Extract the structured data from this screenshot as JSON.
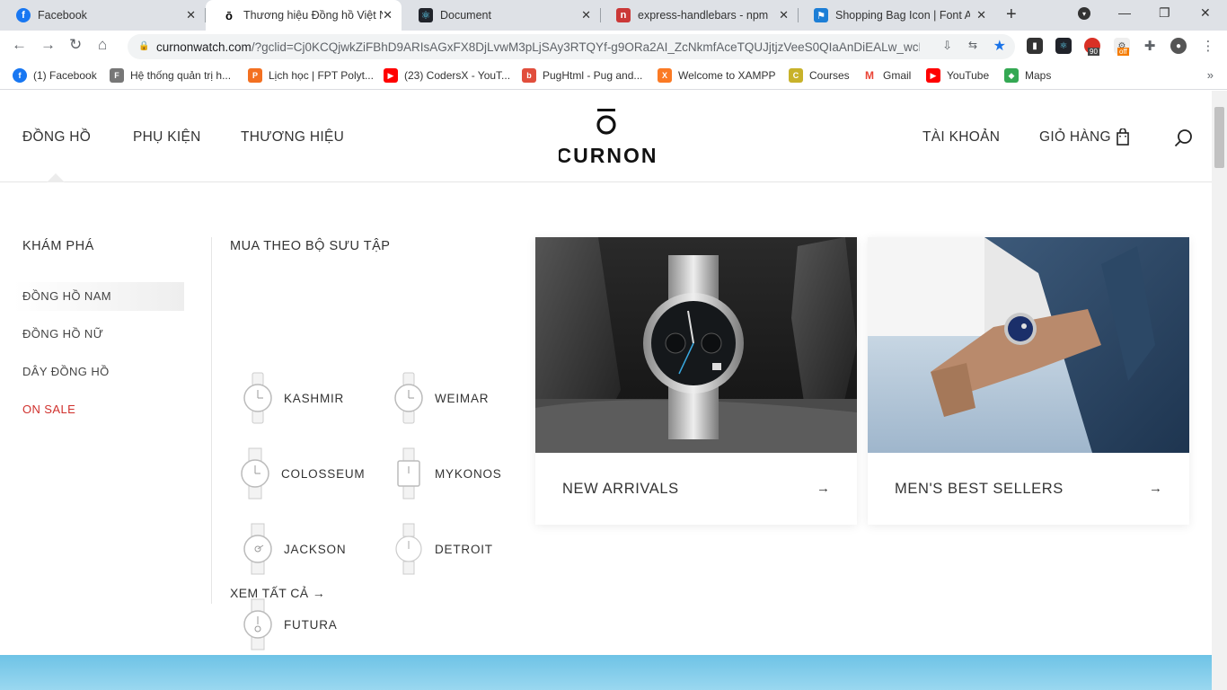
{
  "browser": {
    "tabs": [
      {
        "title": "Facebook",
        "icon": "facebook-icon",
        "color": "#1877f2"
      },
      {
        "title": "Thương hiệu Đồng hồ Việt Nam",
        "icon": "curnon-icon",
        "color": "#000000"
      },
      {
        "title": "Document",
        "icon": "react-icon",
        "color": "#20232a"
      },
      {
        "title": "express-handlebars - npm",
        "icon": "npm-icon",
        "color": "#cb3837"
      },
      {
        "title": "Shopping Bag Icon | Font Awesome",
        "icon": "flag-icon",
        "color": "#1c7ed6"
      }
    ],
    "url_host": "curnonwatch.com",
    "url_rest": "/?gclid=Cj0KCQjwkZiFBhD9ARIsAGxFX8DjLvwM3pLjSAy3RTQYf-g9ORa2AI_ZcNkmfAceTQUJjtjzVeeS0QIaAnDiEALw_wcB",
    "ext_badges": {
      "adblock": "90",
      "coupon": "off"
    },
    "bookmarks": [
      {
        "label": "(1) Facebook",
        "icon": "facebook-icon",
        "color": "#1877f2"
      },
      {
        "label": "Hệ thống quản trị h...",
        "icon": "fpt-icon",
        "color": "#666666"
      },
      {
        "label": "Lịch học | FPT Polyt...",
        "icon": "fpt-polytechnic-icon",
        "color": "#f37021"
      },
      {
        "label": "(23) CodersX - YouT...",
        "icon": "youtube-icon",
        "color": "#ff0000"
      },
      {
        "label": "PugHtml - Pug and...",
        "icon": "pughtml-icon",
        "color": "#e14e3c"
      },
      {
        "label": "Welcome to XAMPP",
        "icon": "xampp-icon",
        "color": "#fb7a24"
      },
      {
        "label": "Courses",
        "icon": "courses-icon",
        "color": "#c8b22a"
      },
      {
        "label": "Gmail",
        "icon": "gmail-icon",
        "color": "#ea4335"
      },
      {
        "label": "YouTube",
        "icon": "youtube-icon",
        "color": "#ff0000"
      },
      {
        "label": "Maps",
        "icon": "maps-icon",
        "color": "#34a853"
      }
    ]
  },
  "site": {
    "nav_left": [
      "ĐỒNG HỒ",
      "PHỤ KIỆN",
      "THƯƠNG HIỆU"
    ],
    "logo_text": "CURNON",
    "nav_right": {
      "account": "TÀI KHOẢN",
      "cart": "GIỎ HÀNG"
    },
    "menu": {
      "explore_title": "KHÁM PHÁ",
      "explore_items": [
        {
          "label": "ĐỒNG HỒ NAM",
          "active": true
        },
        {
          "label": "ĐỒNG HỒ NỮ",
          "active": false
        },
        {
          "label": "DÂY ĐỒNG HỒ",
          "active": false
        },
        {
          "label": "ON SALE",
          "active": false,
          "color": "#d0312d"
        }
      ],
      "collection_title": "MUA THEO BỘ SƯU TẬP",
      "collections": [
        "KASHMIR",
        "WEIMAR",
        "COLOSSEUM",
        "MYKONOS",
        "JACKSON",
        "DETROIT",
        "FUTURA"
      ],
      "see_all": "XEM TẤT CẢ →",
      "cards": [
        {
          "label": "NEW ARRIVALS",
          "arrow": "→"
        },
        {
          "label": "MEN'S BEST SELLERS",
          "arrow": "→"
        }
      ]
    }
  }
}
